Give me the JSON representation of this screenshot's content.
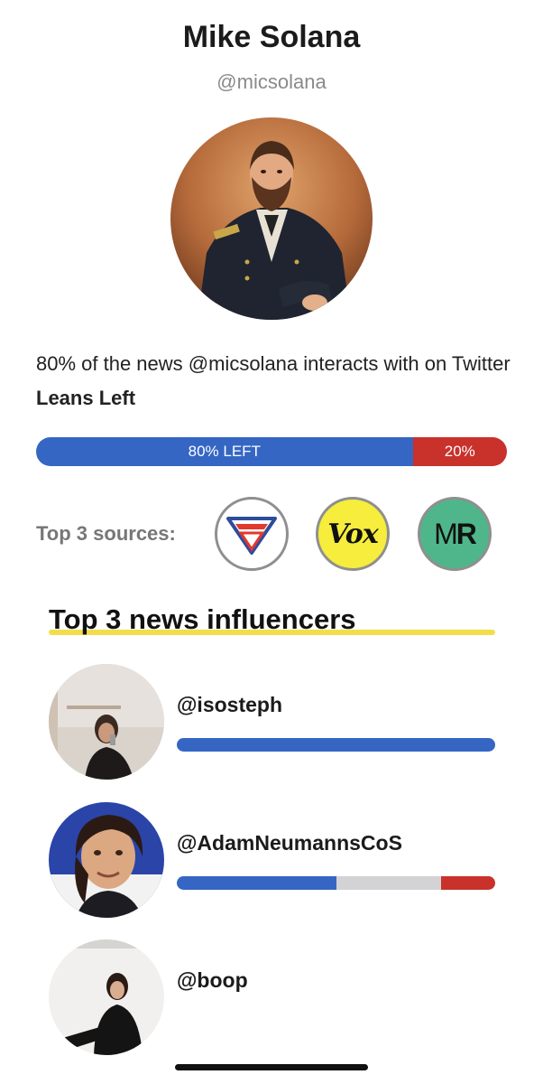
{
  "profile": {
    "name": "Mike Solana",
    "handle": "@micsolana"
  },
  "summary": {
    "text_prefix": "80% of the news @micsolana interacts with on Twitter ",
    "lean_label": "Leans Left"
  },
  "lean_bar": {
    "left_fraction": 0.8,
    "right_fraction": 0.2,
    "left_label": "80% LEFT",
    "right_label": "20%",
    "left_color": "#3566c4",
    "right_color": "#c9312b"
  },
  "sources": {
    "label": "Top 3 sources:",
    "items": [
      {
        "name": "verge-logo",
        "text": ""
      },
      {
        "name": "vox-logo",
        "text": "Vox"
      },
      {
        "name": "marginal-revolution-logo",
        "text_a": "M",
        "text_b": "R"
      }
    ]
  },
  "influencers": {
    "title": "Top 3 news influencers",
    "items": [
      {
        "handle": "@isosteph",
        "lean": {
          "left": 1.0,
          "center": 0.0,
          "right": 0.0
        }
      },
      {
        "handle": "@AdamNeumannsCoS",
        "lean": {
          "left": 0.5,
          "center": 0.33,
          "right": 0.17
        }
      },
      {
        "handle": "@boop",
        "lean": {
          "left": 0,
          "center": 0,
          "right": 0
        }
      }
    ]
  },
  "colors": {
    "left": "#3566c4",
    "center": "#d3d3d6",
    "right": "#c9312b",
    "highlight": "#f2de4a"
  }
}
